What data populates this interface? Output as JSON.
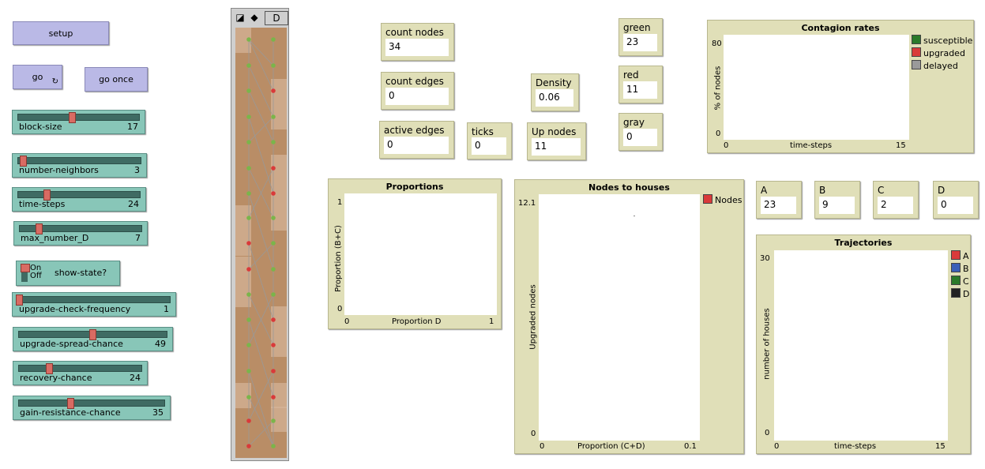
{
  "buttons": {
    "setup": "setup",
    "go": "go",
    "go_once": "go once"
  },
  "sliders": [
    {
      "id": "block-size",
      "name": "block-size",
      "value": "17",
      "fraction": 0.44
    },
    {
      "id": "number-neighbors",
      "name": "number-neighbors",
      "value": "3",
      "fraction": 0.03
    },
    {
      "id": "time-steps",
      "name": "time-steps",
      "value": "24",
      "fraction": 0.23
    },
    {
      "id": "max-number-d",
      "name": "max_number_D",
      "value": "7",
      "fraction": 0.15
    },
    {
      "id": "upgrade-check-frequency",
      "name": "upgrade-check-frequency",
      "value": "1",
      "fraction": 0.0
    },
    {
      "id": "upgrade-spread-chance",
      "name": "upgrade-spread-chance",
      "value": "49",
      "fraction": 0.49
    },
    {
      "id": "recovery-chance",
      "name": "recovery-chance",
      "value": "24",
      "fraction": 0.24
    },
    {
      "id": "gain-resistance-chance",
      "name": "gain-resistance-chance",
      "value": "35",
      "fraction": 0.35
    }
  ],
  "switch": {
    "name": "show-state?",
    "on": "On",
    "off": "Off",
    "state": "off"
  },
  "toolbar": {
    "d_label": "D"
  },
  "monitors": {
    "count_nodes": {
      "label": "count nodes",
      "value": "34"
    },
    "count_edges": {
      "label": "count edges",
      "value": "0"
    },
    "active_edges": {
      "label": "active edges",
      "value": "0"
    },
    "ticks": {
      "label": "ticks",
      "value": "0"
    },
    "density": {
      "label": "Density",
      "value": "0.06"
    },
    "up_nodes": {
      "label": "Up nodes",
      "value": "11"
    },
    "green": {
      "label": "green",
      "value": "23"
    },
    "red": {
      "label": "red",
      "value": "11"
    },
    "gray": {
      "label": "gray",
      "value": "0"
    },
    "a": {
      "label": "A",
      "value": "23"
    },
    "b": {
      "label": "B",
      "value": "9"
    },
    "c": {
      "label": "C",
      "value": "2"
    },
    "d": {
      "label": "D",
      "value": "0"
    }
  },
  "plots": {
    "contagion": {
      "title": "Contagion rates",
      "ylabel": "% of nodes",
      "xlabel": "time-steps",
      "ymax": "80",
      "ymin": "0",
      "xmin": "0",
      "xmax": "15",
      "legend": [
        {
          "name": "susceptible",
          "color": "#2a7a2a"
        },
        {
          "name": "upgraded",
          "color": "#d93a3a"
        },
        {
          "name": "delayed",
          "color": "#9a9a9a"
        }
      ]
    },
    "proportions": {
      "title": "Proportions",
      "ylabel": "Proportion (B+C)",
      "xlabel": "Proportion D",
      "ymax": "1",
      "ymin": "0",
      "xmin": "0",
      "xmax": "1"
    },
    "nodes_to_houses": {
      "title": "Nodes to houses",
      "ylabel": "Upgraded nodes",
      "xlabel": "Proportion (C+D)",
      "ymax": "12.1",
      "ymin": "0",
      "xmin": "0",
      "xmax": "0.1",
      "legend": [
        {
          "name": "Nodes",
          "color": "#d93a3a"
        }
      ]
    },
    "trajectories": {
      "title": "Trajectories",
      "ylabel": "number of houses",
      "xlabel": "time-steps",
      "ymax": "30",
      "ymin": "0",
      "xmin": "0",
      "xmax": "15",
      "legend": [
        {
          "name": "A",
          "color": "#d93a3a"
        },
        {
          "name": "B",
          "color": "#3a5fb8"
        },
        {
          "name": "C",
          "color": "#2a7a2a"
        },
        {
          "name": "D",
          "color": "#222222"
        }
      ]
    }
  },
  "world_colors": {
    "patch_dark": "#b98d66",
    "patch_light": "#d6b59a",
    "green_node": "#7ab54a",
    "red_node": "#d93a3a",
    "edge": "#999999"
  }
}
